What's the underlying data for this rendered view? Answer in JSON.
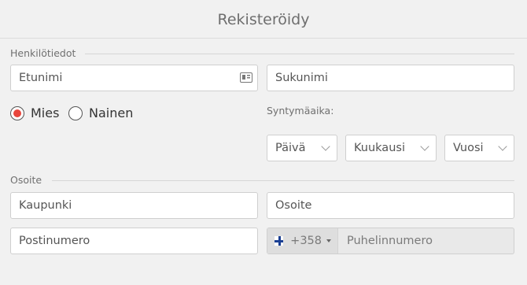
{
  "page": {
    "title": "Rekisteröidy"
  },
  "personal": {
    "section_label": "Henkilötiedot",
    "first_name_placeholder": "Etunimi",
    "last_name_placeholder": "Sukunimi",
    "gender": {
      "options": [
        "Mies",
        "Nainen"
      ],
      "selected": "Mies"
    },
    "birthdate": {
      "label": "Syntymäaika:",
      "day": "Päivä",
      "month": "Kuukausi",
      "year": "Vuosi"
    }
  },
  "address": {
    "section_label": "Osoite",
    "city_placeholder": "Kaupunki",
    "street_placeholder": "Osoite",
    "postal_placeholder": "Postinumero",
    "phone": {
      "dial_code": "+358",
      "placeholder": "Puhelinnumero"
    }
  },
  "colors": {
    "radio_selected": "#e8453c",
    "flag_blue": "#1a3f93"
  }
}
